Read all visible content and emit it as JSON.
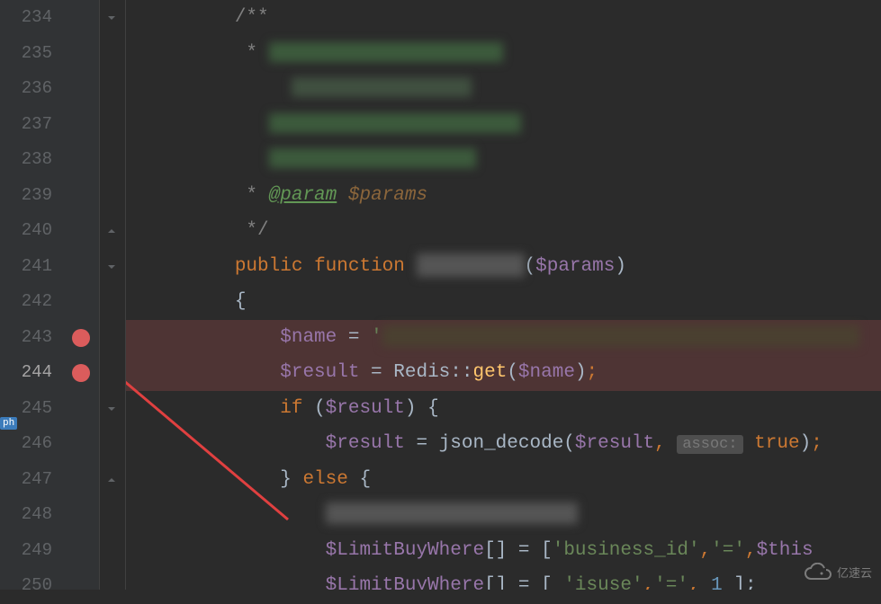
{
  "lineStart": 234,
  "lineEnd": 250,
  "activeLine": 244,
  "breakpoints": [
    243,
    244
  ],
  "foldMarkers": [
    {
      "line": 234,
      "type": "down"
    },
    {
      "line": 240,
      "type": "up"
    },
    {
      "line": 241,
      "type": "down"
    },
    {
      "line": 245,
      "type": "down"
    },
    {
      "line": 247,
      "type": "up"
    }
  ],
  "phLabel": "ph",
  "watermark": "亿速云",
  "code": {
    "l234": {
      "indent": "        ",
      "comment_open": "/**"
    },
    "l235": {
      "indent": "         ",
      "star": "*",
      "blurred": "■ ■ ■■■■■■■■■■"
    },
    "l236": {
      "indent": "         ",
      "star": " ",
      "blurred": "   ■■■■■   ■■"
    },
    "l237": {
      "indent": "         ",
      "star": " ",
      "blurred": "■  ■■■■  ■■■■■■ ,"
    },
    "l238": {
      "indent": "         ",
      "star": " ",
      "blurred": "■ ■■■■  ■■■■ ■"
    },
    "l239": {
      "indent": "         ",
      "star": "* ",
      "doctag": "@param",
      "docvar": " $params"
    },
    "l240": {
      "indent": "         ",
      "comment_close": "*/"
    },
    "l241": {
      "indent": "        ",
      "kw_public": "public",
      "kw_function": "function",
      "func_blur": "■■■■■■■",
      "param": "$params"
    },
    "l242": {
      "indent": "        ",
      "brace": "{"
    },
    "l243": {
      "indent": "            ",
      "var": "$name",
      "eq": " = ",
      "string_blur": "'■■■■■■■■■ ■ ■■■■■■■■ ■■■■■■■■■■■_■■■,"
    },
    "l244": {
      "indent": "            ",
      "var": "$result",
      "eq": " = ",
      "class": "Redis",
      "dcolon": "::",
      "method": "get",
      "arg": "$name"
    },
    "l245": {
      "indent": "            ",
      "kw_if": "if",
      "cond": "$result",
      "brace": " {"
    },
    "l246": {
      "indent": "                ",
      "var": "$result",
      "eq": " = ",
      "func": "json_decode",
      "arg1": "$result",
      "comma": ",",
      "hint": "assoc:",
      "true": "true"
    },
    "l247": {
      "indent": "            ",
      "brace_close": "}",
      "kw_else": "else",
      "brace_open": "{"
    },
    "l248": {
      "indent": "                ",
      "blurred": "■■■■■■ ■■■■■■■■■■"
    },
    "l249": {
      "indent": "                ",
      "var": "$LimitBuyWhere",
      "brackets": "[]",
      "eq": " = ",
      "arr_open": "[",
      "str1": "'business_id'",
      "c1": ",",
      "str2": "'='",
      "c2": ",",
      "tail": "$this"
    },
    "l250": {
      "indent": "                ",
      "var": "$LimitBuyWhere",
      "brackets": "[]",
      "eq": " = ",
      "arr_open": "[ ",
      "str1": "'isuse'",
      "c1": ",",
      "str2": "'='",
      "c2": ",",
      "num": " 1 ",
      "arr_close": "];"
    }
  }
}
